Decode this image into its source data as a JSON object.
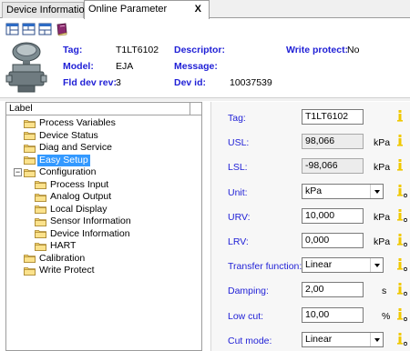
{
  "tabs": [
    {
      "label": "Device Information",
      "active": false
    },
    {
      "label": "Online Parameter",
      "active": true,
      "close": "X"
    }
  ],
  "toolbar": {
    "icons": [
      "window-tile-icon",
      "window-split-icon",
      "window-layout-icon",
      "book-icon"
    ]
  },
  "device": {
    "icon": "pressure-transmitter-icon",
    "tag_label": "Tag:",
    "tag_value": "T1LT6102",
    "descriptor_label": "Descriptor:",
    "descriptor_value": "",
    "write_protect_label": "Write protect:",
    "write_protect_value": "No",
    "model_label": "Model:",
    "model_value": "EJA",
    "message_label": "Message:",
    "message_value": "",
    "fld_dev_rev_label": "Fld dev rev:",
    "fld_dev_rev_value": "3",
    "dev_id_label": "Dev id:",
    "dev_id_value": "10037539"
  },
  "tree": {
    "header": "Label",
    "items": [
      {
        "label": "Process Variables",
        "level": 0,
        "selected": false
      },
      {
        "label": "Device Status",
        "level": 0,
        "selected": false
      },
      {
        "label": "Diag and Service",
        "level": 0,
        "selected": false
      },
      {
        "label": "Easy Setup",
        "level": 0,
        "selected": true
      },
      {
        "label": "Configuration",
        "level": 0,
        "selected": false,
        "expander": "−"
      },
      {
        "label": "Process Input",
        "level": 1,
        "selected": false
      },
      {
        "label": "Analog Output",
        "level": 1,
        "selected": false
      },
      {
        "label": "Local Display",
        "level": 1,
        "selected": false
      },
      {
        "label": "Sensor Information",
        "level": 1,
        "selected": false
      },
      {
        "label": "Device Information",
        "level": 1,
        "selected": false
      },
      {
        "label": "HART",
        "level": 1,
        "selected": false
      },
      {
        "label": "Calibration",
        "level": 0,
        "selected": false
      },
      {
        "label": "Write Protect",
        "level": 0,
        "selected": false
      }
    ]
  },
  "params": [
    {
      "label": "Tag:",
      "value": "T1LT6102",
      "unit": "",
      "kind": "edit",
      "info": "info-icon"
    },
    {
      "label": "USL:",
      "value": "98,066",
      "unit": "kPa",
      "kind": "readonly",
      "info": "info-icon"
    },
    {
      "label": "LSL:",
      "value": "-98,066",
      "unit": "kPa",
      "kind": "readonly",
      "info": "info-icon"
    },
    {
      "label": "Unit:",
      "value": "kPa",
      "unit": "",
      "kind": "select",
      "info": "info-edit-icon"
    },
    {
      "label": "URV:",
      "value": "10,000",
      "unit": "kPa",
      "kind": "edit",
      "info": "info-edit-icon"
    },
    {
      "label": "LRV:",
      "value": "0,000",
      "unit": "kPa",
      "kind": "edit",
      "info": "info-edit-icon"
    },
    {
      "label": "Transfer function:",
      "value": "Linear",
      "unit": "",
      "kind": "select",
      "info": "info-edit-icon"
    },
    {
      "label": "Damping:",
      "value": "2,00",
      "unit": "s",
      "kind": "edit",
      "info": "info-edit-icon"
    },
    {
      "label": "Low cut:",
      "value": "10,00",
      "unit": "%",
      "kind": "edit",
      "info": "info-edit-icon"
    },
    {
      "label": "Cut mode:",
      "value": "Linear",
      "unit": "",
      "kind": "select",
      "info": "info-edit-icon"
    }
  ],
  "colors": {
    "label_blue": "#1f1fd6",
    "selection": "#3399ff",
    "info_yellow": "#f0c800"
  }
}
